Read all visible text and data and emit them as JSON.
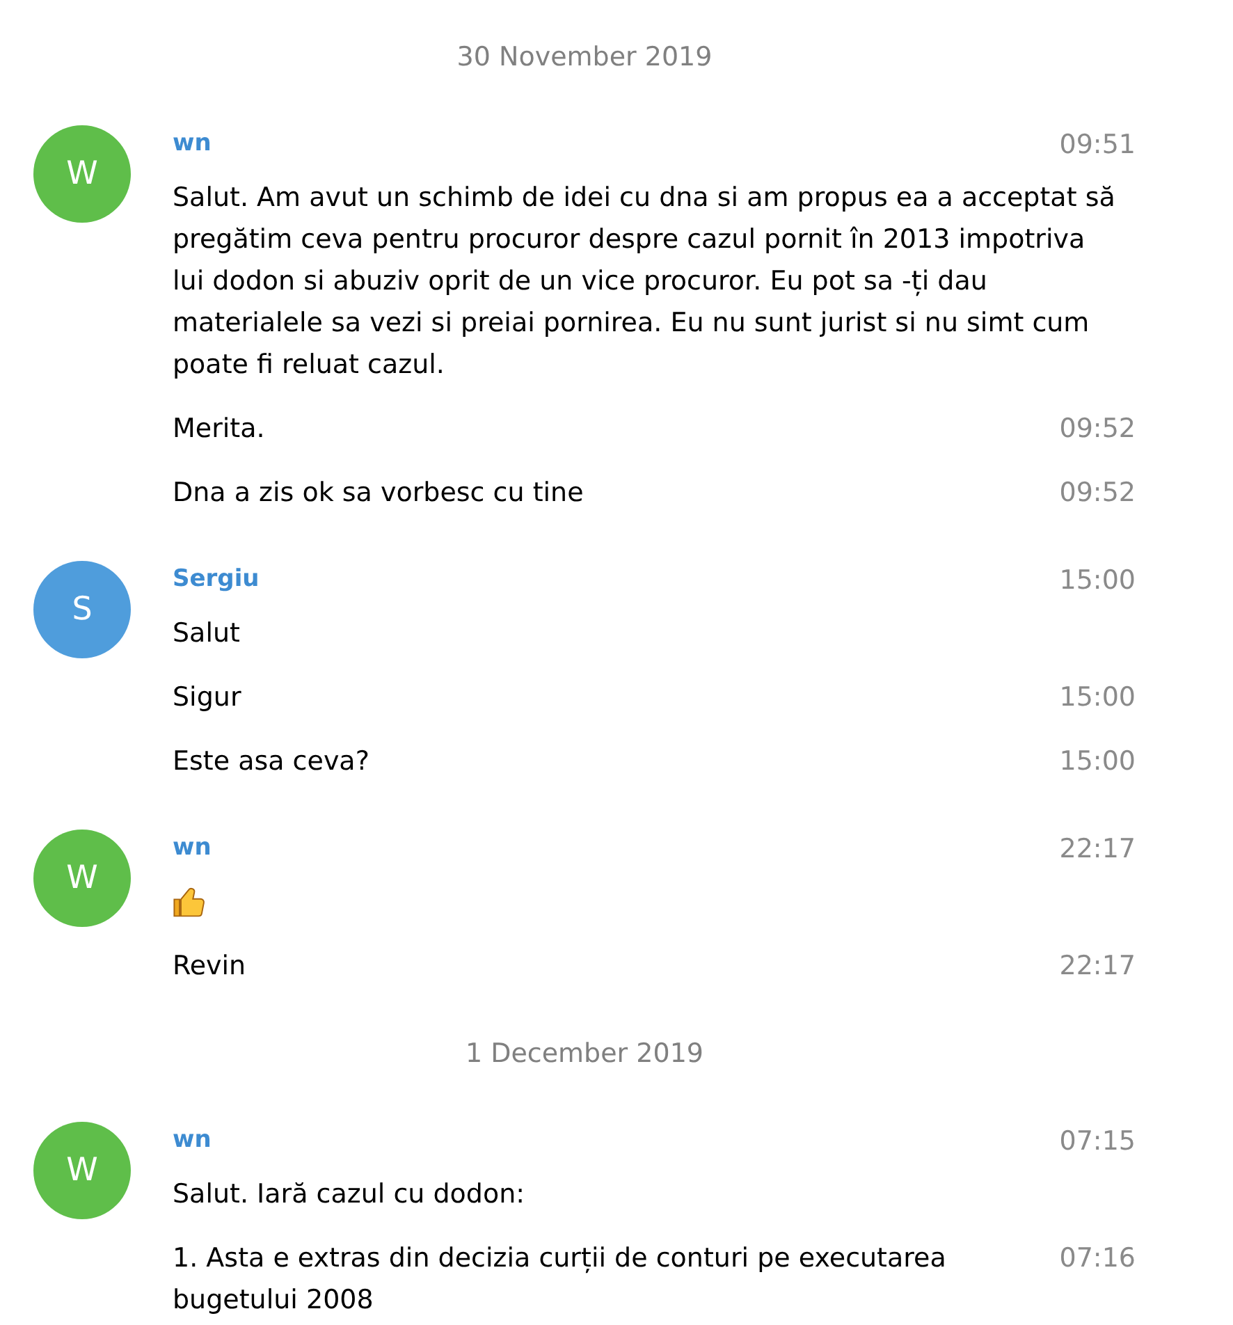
{
  "timeline": [
    {
      "kind": "date",
      "label": "30 November 2019"
    },
    {
      "kind": "group",
      "sender": {
        "name": "wn",
        "initial": "W",
        "color": "#5fbe4a"
      },
      "time": "09:51",
      "messages": [
        {
          "kind": "text",
          "text": "Salut. Am avut un schimb de idei cu dna si am propus ea a acceptat să pregătim ceva pentru procuror despre cazul pornit în 2013 impotriva lui dodon si abuziv oprit de un vice procuror. Eu pot sa -ți dau materialele sa vezi si preiai pornirea. Eu nu sunt jurist si nu simt cum poate fi reluat cazul."
        },
        {
          "kind": "text",
          "text": "Merita.",
          "time": "09:52"
        },
        {
          "kind": "text",
          "text": "Dna a zis ok sa vorbesc cu tine",
          "time": "09:52"
        }
      ]
    },
    {
      "kind": "group",
      "sender": {
        "name": "Sergiu",
        "initial": "S",
        "color": "#4f9ddc"
      },
      "time": "15:00",
      "messages": [
        {
          "kind": "text",
          "text": "Salut"
        },
        {
          "kind": "text",
          "text": "Sigur",
          "time": "15:00"
        },
        {
          "kind": "text",
          "text": "Este asa ceva?",
          "time": "15:00"
        }
      ]
    },
    {
      "kind": "group",
      "sender": {
        "name": "wn",
        "initial": "W",
        "color": "#5fbe4a"
      },
      "time": "22:17",
      "messages": [
        {
          "kind": "emoji"
        },
        {
          "kind": "text",
          "text": "Revin",
          "time": "22:17"
        }
      ]
    },
    {
      "kind": "date",
      "label": "1 December 2019"
    },
    {
      "kind": "group",
      "sender": {
        "name": "wn",
        "initial": "W",
        "color": "#5fbe4a"
      },
      "time": "07:15",
      "messages": [
        {
          "kind": "text",
          "text": "Salut. Iară cazul cu dodon:"
        },
        {
          "kind": "text",
          "text": "1. Asta e extras din decizia curții de conturi pe executarea bugetului 2008",
          "time": "07:16"
        }
      ]
    }
  ]
}
